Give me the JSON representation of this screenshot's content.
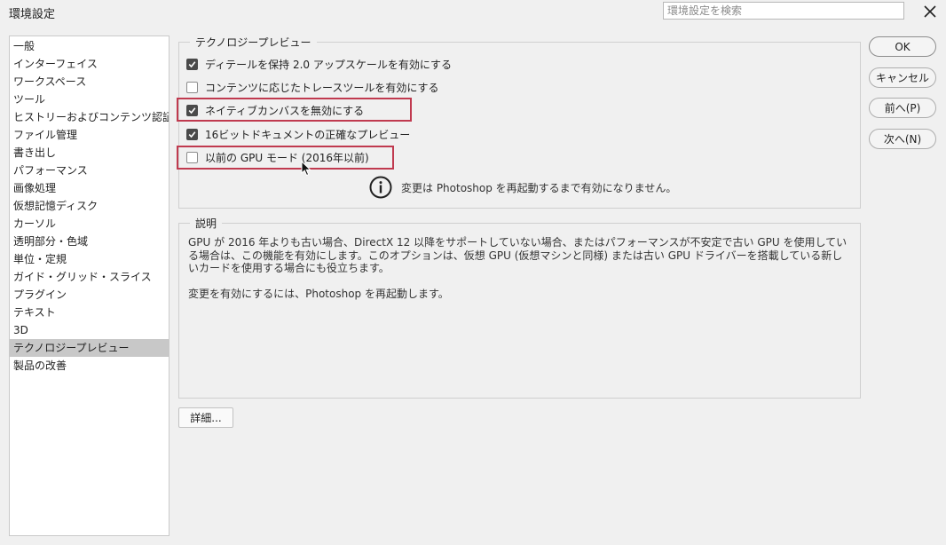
{
  "window": {
    "title": "環境設定"
  },
  "search": {
    "placeholder": "環境設定を検索"
  },
  "sidebar": {
    "items": [
      {
        "label": "一般"
      },
      {
        "label": "インターフェイス"
      },
      {
        "label": "ワークスペース"
      },
      {
        "label": "ツール"
      },
      {
        "label": "ヒストリーおよびコンテンツ認証情報"
      },
      {
        "label": "ファイル管理"
      },
      {
        "label": "書き出し"
      },
      {
        "label": "パフォーマンス"
      },
      {
        "label": "画像処理"
      },
      {
        "label": "仮想記憶ディスク"
      },
      {
        "label": "カーソル"
      },
      {
        "label": "透明部分・色域"
      },
      {
        "label": "単位・定規"
      },
      {
        "label": "ガイド・グリッド・スライス"
      },
      {
        "label": "プラグイン"
      },
      {
        "label": "テキスト"
      },
      {
        "label": "3D"
      },
      {
        "label": "テクノロジープレビュー",
        "selected": true
      },
      {
        "label": "製品の改善"
      }
    ]
  },
  "tech_preview": {
    "legend": "テクノロジープレビュー",
    "options": [
      {
        "label": "ディテールを保持 2.0 アップスケールを有効にする",
        "checked": true
      },
      {
        "label": "コンテンツに応じたトレースツールを有効にする",
        "checked": false
      },
      {
        "label": "ネイティブカンバスを無効にする",
        "checked": true
      },
      {
        "label": "16ビットドキュメントの正確なプレビュー",
        "checked": true
      },
      {
        "label": "以前の GPU モード (2016年以前)",
        "checked": false
      }
    ],
    "restart_note": "変更は Photoshop を再起動するまで有効になりません。"
  },
  "description": {
    "legend": "説明",
    "paragraph1": "GPU が 2016 年よりも古い場合、DirectX 12 以降をサポートしていない場合、またはパフォーマンスが不安定で古い GPU を使用している場合は、この機能を有効にします。このオプションは、仮想 GPU (仮想マシンと同様) または古い GPU ドライバーを搭載している新しいカードを使用する場合にも役立ちます。",
    "paragraph2": "変更を有効にするには、Photoshop を再起動します。"
  },
  "buttons": {
    "ok": "OK",
    "cancel": "キャンセル",
    "prev": "前へ(P)",
    "next": "次へ(N)",
    "details": "詳細..."
  },
  "colors": {
    "highlight": "#c03a4f",
    "selected_bg": "#c8c8c8"
  }
}
